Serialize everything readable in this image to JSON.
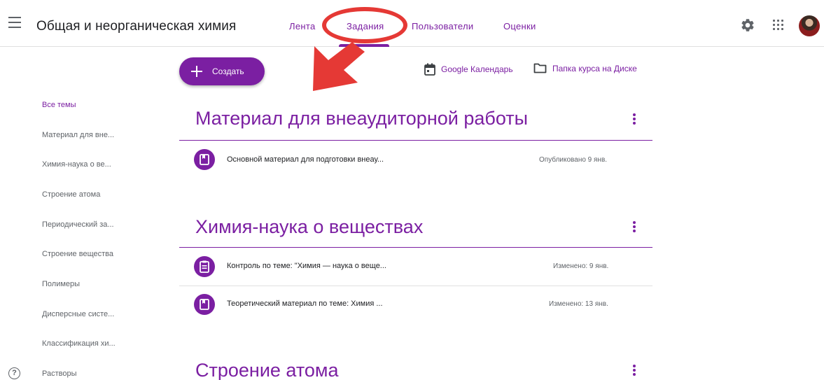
{
  "header": {
    "title": "Общая и неорганическая химия",
    "tabs": [
      {
        "label": "Лента"
      },
      {
        "label": "Задания"
      },
      {
        "label": "Пользователи"
      },
      {
        "label": "Оценки"
      }
    ]
  },
  "toolbar": {
    "create_label": "Создать",
    "calendar_label": "Google Календарь",
    "drive_label": "Папка курса на Диске"
  },
  "sidebar": {
    "items": [
      {
        "label": "Все темы"
      },
      {
        "label": "Материал для вне..."
      },
      {
        "label": "Химия-наука о ве..."
      },
      {
        "label": "Строение атома"
      },
      {
        "label": "Периодический за..."
      },
      {
        "label": "Строение вещества"
      },
      {
        "label": "Полимеры"
      },
      {
        "label": "Дисперсные систе..."
      },
      {
        "label": "Классификация хи..."
      },
      {
        "label": "Растворы"
      }
    ]
  },
  "sections": [
    {
      "title": "Материал для внеаудиторной работы",
      "items": [
        {
          "title": "Основной материал для подготовки внеау...",
          "status": "Опубликовано 9 янв.",
          "icon": "book-icon"
        }
      ]
    },
    {
      "title": "Химия-наука о веществах",
      "items": [
        {
          "title": "Контроль по теме: \"Химия — наука о веще...",
          "status": "Изменено: 9 янв.",
          "icon": "assignment-icon"
        },
        {
          "title": "Теоретический материал по теме: Химия ...",
          "status": "Изменено: 13 янв.",
          "icon": "book-icon"
        }
      ]
    },
    {
      "title": "Строение атома",
      "items": []
    }
  ],
  "colors": {
    "accent": "#7b1fa2",
    "annotation": "#e53935"
  }
}
